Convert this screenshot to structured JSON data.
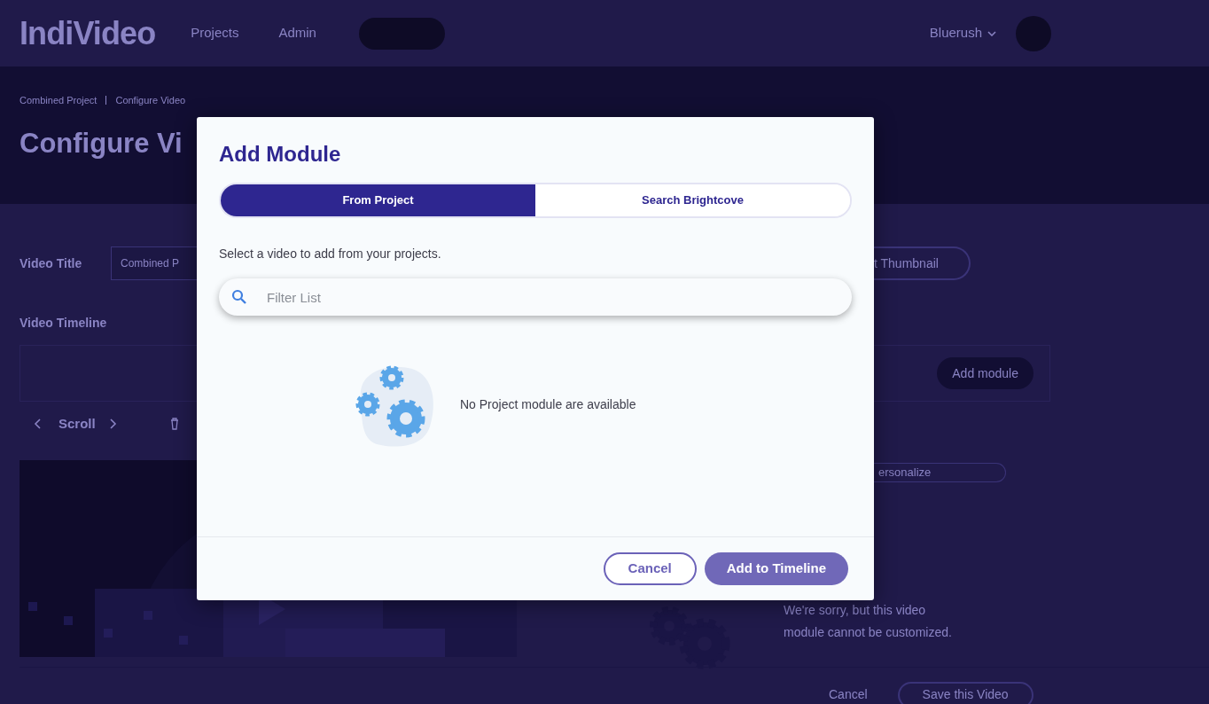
{
  "header": {
    "logo": "IndiVideo",
    "nav": [
      {
        "label": "Projects"
      },
      {
        "label": "Admin"
      }
    ],
    "account": "Bluerush"
  },
  "breadcrumbs": [
    "Combined Project",
    "Configure Video"
  ],
  "page_title": "Configure Vi",
  "video_title": {
    "label": "Video Title",
    "value": "Combined P"
  },
  "thumbnail_button": "t Thumbnail",
  "timeline": {
    "label": "Video Timeline",
    "add_button": "Add module",
    "scroll_label": "Scroll"
  },
  "personalize_field": "ersonalize",
  "customize_message": "We're sorry, but this video module cannot be customized.",
  "footer": {
    "cancel": "Cancel",
    "save": "Save this Video"
  },
  "modal": {
    "title": "Add Module",
    "tabs": [
      {
        "label": "From Project",
        "selected": true
      },
      {
        "label": "Search Brightcove",
        "selected": false
      }
    ],
    "instructions": "Select a video to add from your projects.",
    "filter": {
      "placeholder": "Filter List"
    },
    "empty_message": "No Project module are available",
    "buttons": [
      {
        "label": "Cancel",
        "kind": "secondary",
        "disabled": false
      },
      {
        "label": "Add to Timeline",
        "kind": "primary",
        "disabled": true
      }
    ]
  }
}
